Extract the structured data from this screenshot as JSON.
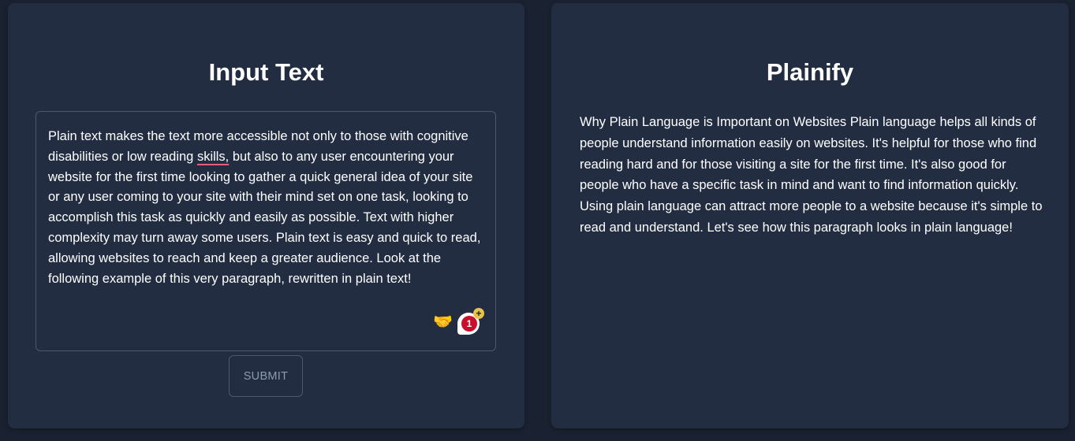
{
  "input_panel": {
    "title": "Input Text",
    "text_before": "Plain text makes the text more accessible not only to those with cognitive disabilities or low reading ",
    "text_flagged": "skills,",
    "text_after": " but also to any user encountering your website for the first time looking to gather a quick general idea of your site or any user coming to your site with their mind set on one task, looking to accomplish this task as quickly and easily as possible. Text with higher complexity may turn away some users. Plain text is easy and quick to read, allowing websites to reach and keep a greater audience. Look at the following example of this very paragraph, rewritten in plain text!",
    "extension_badge_count": "1",
    "extension_badge_plus": "+",
    "handshake_icon": "handshake-icon",
    "submit_label": "SUBMIT"
  },
  "output_panel": {
    "title": "Plainify",
    "text": "Why Plain Language is Important on Websites Plain language helps all kinds of people understand information easily on websites. It's helpful for those who find reading hard and for those visiting a site for the first time. It's also good for people who have a specific task in mind and want to find information quickly. Using plain language can attract more people to a website because it's simple to read and understand. Let's see how this paragraph looks in plain language!"
  },
  "colors": {
    "background": "#1a2232",
    "panel": "#222d42",
    "border": "#4c5870",
    "text": "#ffffff",
    "button_text": "#8d9ab0",
    "spellcheck_underline": "#e35d7d",
    "badge_red": "#c8102e"
  }
}
